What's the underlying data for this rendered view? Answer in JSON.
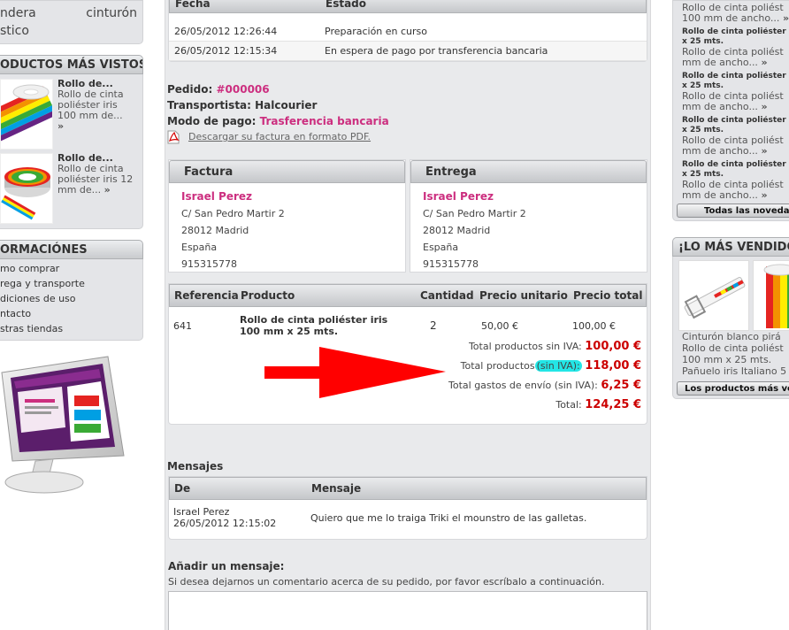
{
  "left": {
    "category": {
      "word1": "ndera",
      "word2": "cinturón",
      "word3": "stico"
    },
    "most_viewed": {
      "title": "ODUCTOS MÁS VISTOS",
      "items": [
        {
          "title": "Rollo de...",
          "desc": "Rollo de cinta poliéster iris 100 mm de...",
          "more": "»"
        },
        {
          "title": "Rollo de...",
          "desc": "Rollo de cinta poliéster iris 12 mm de...",
          "more": "»"
        }
      ]
    },
    "info": {
      "title": "ORMACIÓNES",
      "items": [
        "mo comprar",
        "rega y transporte",
        "diciones de uso",
        "ntacto",
        "stras tiendas"
      ]
    }
  },
  "history": {
    "col_date": "Fecha",
    "col_state": "Estado",
    "rows": [
      {
        "date": "26/05/2012 12:26:44",
        "state": "Preparación en curso"
      },
      {
        "date": "26/05/2012 12:15:34",
        "state": "En espera de pago por transferencia bancaria"
      }
    ]
  },
  "order": {
    "label_order": "Pedido:",
    "order_id": "#000006",
    "label_carrier": "Transportista:",
    "carrier": "Halcourier",
    "label_payment": "Modo de pago:",
    "payment": "Trasferencia bancaria",
    "pdf_link": "Descargar su factura en formato PDF."
  },
  "invoice": {
    "title": "Factura",
    "name": "Israel Perez",
    "street": "C/ San Pedro Martir 2",
    "city": "28012 Madrid",
    "country": "España",
    "phone": "915315778"
  },
  "delivery": {
    "title": "Entrega",
    "name": "Israel Perez",
    "street": "C/ San Pedro Martir 2",
    "city": "28012 Madrid",
    "country": "España",
    "phone": "915315778"
  },
  "products": {
    "col_ref": "Referencia",
    "col_product": "Producto",
    "col_qty": "Cantidad",
    "col_unit": "Precio unitario",
    "col_total": "Precio total",
    "rows": [
      {
        "ref": "641",
        "name": "Rollo de cinta poliéster iris 100 mm x 25 mts.",
        "qty": "2",
        "unit": "50,00 €",
        "total": "100,00 €"
      }
    ]
  },
  "totals": {
    "products_excl_label": "Total productos sin IVA:",
    "products_excl_value": "100,00 €",
    "products_label": "Total productos",
    "products_label_hl": "(sin IVA):",
    "products_value": "118,00 €",
    "shipping_label": "Total gastos de envío (sin IVA):",
    "shipping_value": "6,25 €",
    "total_label": "Total:",
    "total_value": "124,25 €"
  },
  "messages": {
    "title": "Mensajes",
    "col_from": "De",
    "col_message": "Mensaje",
    "rows": [
      {
        "from": "Israel Perez",
        "date": "26/05/2012 12:15:02",
        "text": "Quiero que me lo traiga Triki el mounstro de las galletas."
      }
    ]
  },
  "add_message": {
    "title": "Añadir un mensaje:",
    "hint": "Si desea dejarnos un comentario acerca de su pedido, por favor escríbalo a continuación."
  },
  "right": {
    "new_items": [
      {
        "name": "Rollo de cinta poliést",
        "name2": "100 mm de ancho...",
        "more": "»"
      },
      {
        "sub": "Rollo de cinta poliéster i",
        "sub2": "x 25 mts.",
        "name": "Rollo de cinta poliést",
        "name2": "mm de ancho...",
        "more": "»"
      },
      {
        "sub": "Rollo de cinta poliéster i",
        "sub2": "x 25 mts.",
        "name": "Rollo de cinta poliést",
        "name2": "mm de ancho...",
        "more": "»"
      },
      {
        "sub": "Rollo de cinta poliéster i",
        "sub2": "x 25 mts.",
        "name": "Rollo de cinta poliést",
        "name2": "mm de ancho...",
        "more": "»"
      },
      {
        "sub": "Rollo de cinta poliéster i",
        "sub2": "x 25 mts.",
        "name": "Rollo de cinta poliést",
        "name2": "mm de ancho...",
        "more": "»"
      }
    ],
    "new_button": "Todas las noveda",
    "best_title": "¡LO MÁS VENDIDO!",
    "best_lines": [
      "Cinturón blanco pirá",
      "Rollo de cinta poliést",
      "100 mm x 25 mts.",
      "Pañuelo iris Italiano 5"
    ],
    "best_button": "Los productos más ve"
  },
  "colors": {
    "accent": "#cc2e7f",
    "price": "#cc0000",
    "highlight": "#23e6e6",
    "arrow": "#ff0000"
  }
}
